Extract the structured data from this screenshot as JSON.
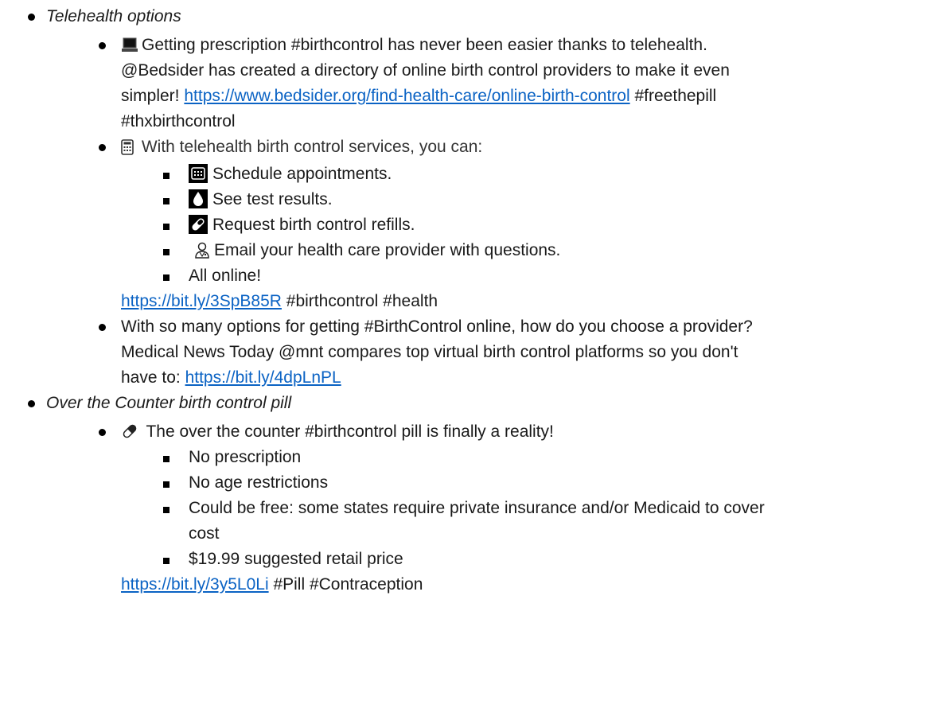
{
  "sections": [
    {
      "heading": "Telehealth options",
      "posts": [
        {
          "icon": "laptop-icon",
          "lines": [
            "Getting prescription #birthcontrol has never been easier thanks to telehealth.",
            "@Bedsider has created a directory of online birth control providers to make it even",
            "simpler! ",
            "#thxbirthcontrol"
          ],
          "link": "https://www.bedsider.org/find-health-care/online-birth-control",
          "after_link": " #freethepill"
        },
        {
          "icon": "calculator-icon",
          "intro": "With telehealth birth control services, you can:",
          "items": [
            {
              "icon": "calendar-icon",
              "text": "Schedule appointments."
            },
            {
              "icon": "drop-icon",
              "text": "See test results."
            },
            {
              "icon": "pill-icon",
              "text": "Request birth control refills."
            },
            {
              "icon": "doctor-icon",
              "text": "Email your health care provider with questions."
            },
            {
              "icon": "",
              "text": "All online!"
            }
          ],
          "link": "https://bit.ly/3SpB85R",
          "after_link": " #birthcontrol #health"
        },
        {
          "lines": [
            "With so many options for getting #BirthControl online, how do you choose a provider?",
            "Medical News Today @mnt compares top virtual birth control platforms so you don't",
            "have to: "
          ],
          "link": "https://bit.ly/4dpLnPL"
        }
      ]
    },
    {
      "heading": "Over the Counter birth control pill",
      "posts": [
        {
          "icon": "pill-icon",
          "intro": "The over the counter #birthcontrol pill is finally a reality!",
          "items": [
            {
              "text": "No prescription"
            },
            {
              "text": "No age restrictions"
            },
            {
              "text": "Could be free: some states require private insurance and/or Medicaid to cover"
            },
            {
              "text": "cost"
            },
            {
              "text": "$19.99 suggested retail price"
            }
          ],
          "link": "https://bit.ly/3y5L0Li",
          "after_link": " #Pill #Contraception"
        }
      ]
    }
  ]
}
